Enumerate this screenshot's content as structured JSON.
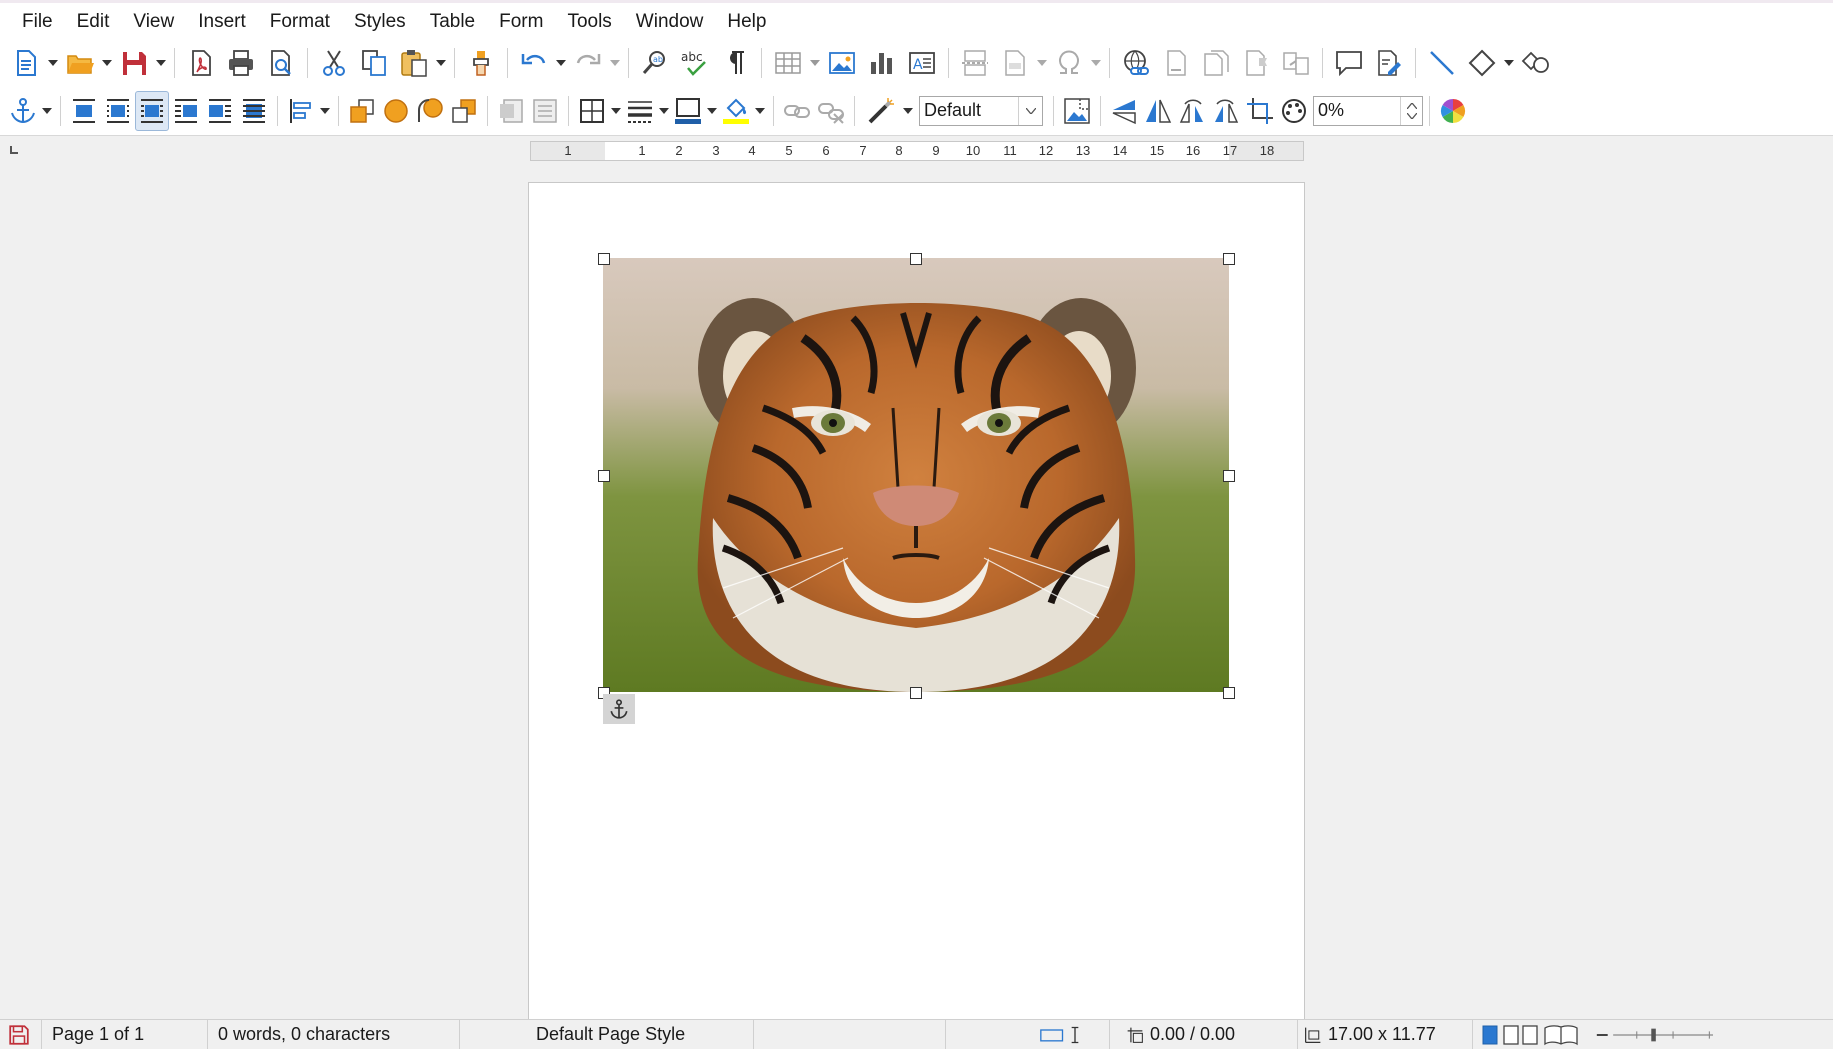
{
  "menu": [
    "File",
    "Edit",
    "View",
    "Insert",
    "Format",
    "Styles",
    "Table",
    "Form",
    "Tools",
    "Window",
    "Help"
  ],
  "toolbar": {
    "frame_style": "Default",
    "transparency": "0%"
  },
  "ruler": {
    "labels": [
      "1",
      "1",
      "2",
      "3",
      "4",
      "5",
      "6",
      "7",
      "8",
      "9",
      "10",
      "11",
      "12",
      "13",
      "14",
      "15",
      "16",
      "17",
      "18"
    ]
  },
  "status": {
    "page": "Page 1 of 1",
    "words": "0 words, 0 characters",
    "page_style": "Default Page Style",
    "position": "0.00 / 0.00",
    "size": "17.00 x 11.77"
  },
  "colors": {
    "accent_blue": "#2b78d0",
    "save_red": "#c0303a",
    "folder_orange": "#f0a020",
    "highlight_yellow": "#ffff00",
    "border_blue": "#1f5fa8"
  },
  "icons": {
    "toolbar1": [
      "new-document-icon",
      "open-icon",
      "save-icon",
      "export-pdf-icon",
      "print-icon",
      "print-preview-icon",
      "cut-icon",
      "copy-icon",
      "paste-icon",
      "clone-formatting-icon",
      "undo-icon",
      "redo-icon",
      "find-replace-icon",
      "spelling-icon",
      "formatting-marks-icon",
      "insert-table-icon",
      "insert-image-icon",
      "insert-chart-icon",
      "insert-textbox-icon",
      "page-break-icon",
      "field-icon",
      "special-character-icon",
      "hyperlink-icon",
      "footnote-icon",
      "endnote-icon",
      "bookmark-icon",
      "cross-reference-icon",
      "comment-icon",
      "track-changes-icon",
      "line-icon",
      "basic-shapes-icon",
      "draw-functions-icon"
    ],
    "toolbar2": [
      "anchor-icon",
      "wrap-off-icon",
      "wrap-page-icon",
      "wrap-optimal-icon",
      "wrap-left-icon",
      "wrap-right-icon",
      "wrap-through-icon",
      "align-objects-icon",
      "bring-to-front-icon",
      "forward-one-icon",
      "backward-one-icon",
      "send-to-back-icon",
      "to-foreground-icon",
      "to-background-icon",
      "borders-icon",
      "border-style-icon",
      "border-color-icon",
      "area-fill-icon",
      "link-frames-icon",
      "unlink-frames-icon",
      "image-filter-icon",
      "image-properties-icon",
      "flip-vertical-icon",
      "flip-horizontal-icon",
      "rotate-left-icon",
      "rotate-right-icon",
      "crop-icon",
      "transparency-icon",
      "color-icon"
    ]
  }
}
